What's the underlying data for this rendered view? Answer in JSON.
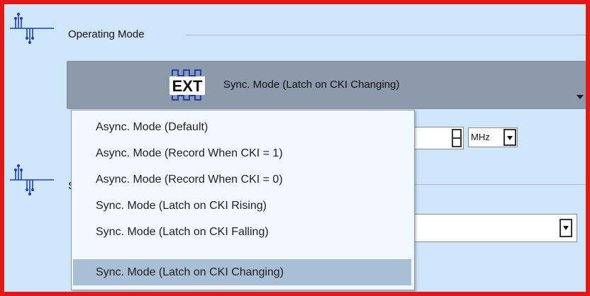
{
  "groups": {
    "operating_mode": {
      "title": "Operating Mode"
    },
    "second_group": {
      "title": "S"
    }
  },
  "mode_button": {
    "icon_text": "EXT",
    "label": "Sync. Mode (Latch on CKI Changing)"
  },
  "frequency": {
    "value": "",
    "unit": "MHz"
  },
  "source_select": {
    "value": ""
  },
  "dropdown": {
    "options": [
      "Async. Mode (Default)",
      "Async. Mode (Record When CKI = 1)",
      "Async. Mode (Record When CKI = 0)",
      "Sync. Mode (Latch on CKI Rising)",
      "Sync. Mode (Latch on CKI Falling)",
      "Sync. Mode (Latch on CKI Changing)"
    ],
    "selected_index": 5
  },
  "colors": {
    "highlight_border": "#e01818",
    "panel_background": "#cfe5f9",
    "button_background": "#8c9aac",
    "selected_option": "#a8bfd6",
    "icon_blue": "#1f3fb0"
  },
  "icons": {
    "group_icon": "signal-waveform-icon",
    "mode_icon": "ext-clock-icon"
  }
}
